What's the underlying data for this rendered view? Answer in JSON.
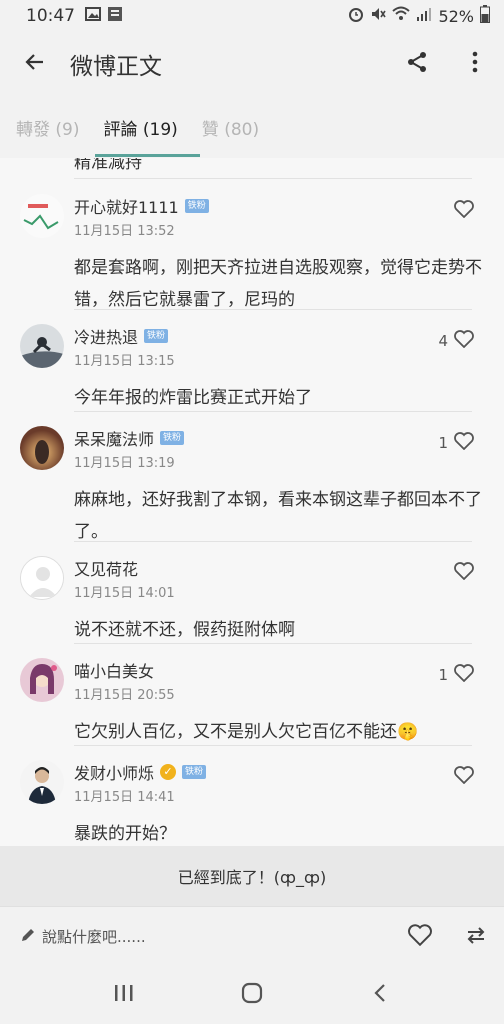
{
  "status": {
    "time": "10:47",
    "battery": "52%"
  },
  "app_bar": {
    "title": "微博正文",
    "icons": [
      "back-arrow-icon",
      "share-icon",
      "more-vert-icon"
    ]
  },
  "tabs": [
    {
      "label": "轉發 (9)",
      "active": false
    },
    {
      "label": "評論 (19)",
      "active": true
    },
    {
      "label": "贊 (80)",
      "active": false
    }
  ],
  "cut_text": "精准减持",
  "comments": [
    {
      "name": "开心就好1111",
      "badge": "铁粉",
      "verified": false,
      "time": "11月15日 13:52",
      "text": "都是套路啊，刚把天齐拉进自选股观察，觉得它走势不错，然后它就暴雷了，尼玛的",
      "likes": ""
    },
    {
      "name": "冷进热退",
      "badge": "铁粉",
      "verified": false,
      "time": "11月15日 13:15",
      "text": "今年年报的炸雷比赛正式开始了",
      "likes": "4"
    },
    {
      "name": "呆呆魔法师",
      "badge": "铁粉",
      "verified": false,
      "time": "11月15日 13:19",
      "text": "麻麻地，还好我割了本钢，看来本钢这辈子都回本不了了。",
      "likes": "1"
    },
    {
      "name": "又见荷花",
      "badge": "",
      "verified": false,
      "time": "11月15日 14:01",
      "text": "说不还就不还，假药挺附体啊",
      "likes": ""
    },
    {
      "name": "喵小白美女",
      "badge": "",
      "verified": false,
      "time": "11月15日 20:55",
      "text": "它欠别人百亿，又不是别人欠它百亿不能还🤫",
      "likes": "1"
    },
    {
      "name": "发财小师烁",
      "badge": "铁粉",
      "verified": true,
      "time": "11月15日 14:41",
      "text": "暴跌的开始？",
      "likes": ""
    }
  ],
  "end_text": "已經到底了！(ȹ_ȹ)",
  "compose": {
    "placeholder": "說點什麼吧......"
  },
  "colors": {
    "accent": "#5aa39a",
    "badge": "#7fb1e4",
    "verified": "#f1b21c"
  }
}
